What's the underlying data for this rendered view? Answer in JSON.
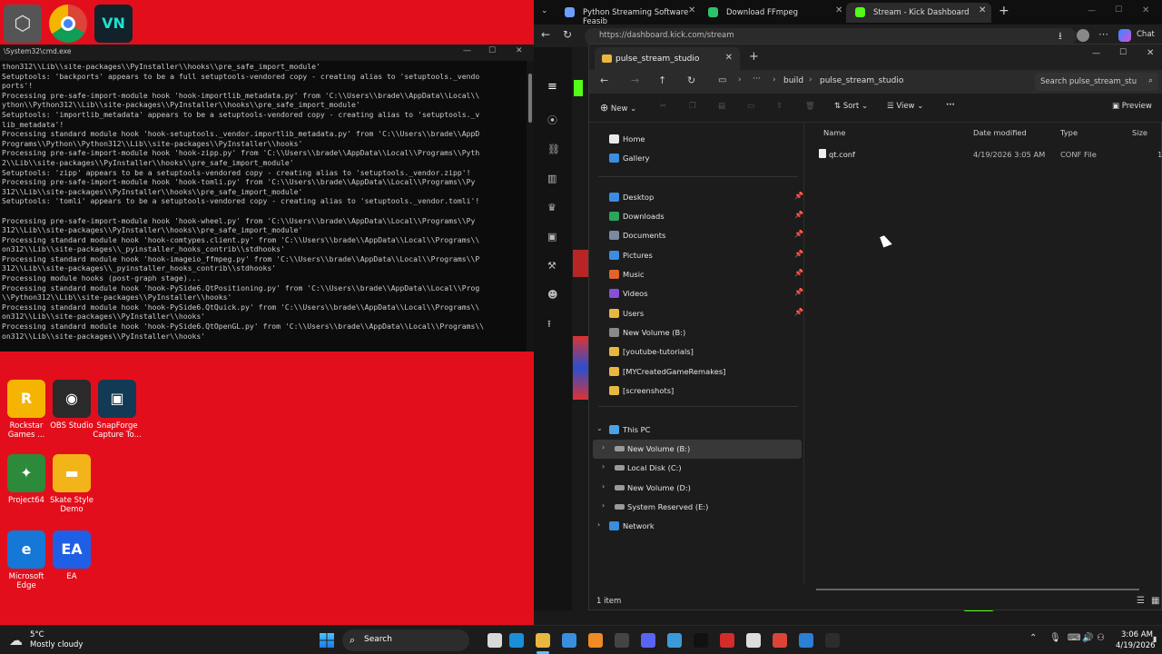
{
  "desktop": {
    "icons_top": [
      {
        "name": "unity"
      },
      {
        "name": "chrome"
      },
      {
        "name": "vegas"
      }
    ],
    "icons": [
      {
        "label": "Rockstar Games ...",
        "glyph": "R",
        "color": "#f5b400"
      },
      {
        "label": "OBS Studio",
        "glyph": "◉",
        "color": "#2a2a2a"
      },
      {
        "label": "SnapForge Capture To...",
        "glyph": "▣",
        "color": "#123a55"
      },
      {
        "label": "Project64",
        "glyph": "✦",
        "color": "#2c8a3a"
      },
      {
        "label": "Skate Style Demo",
        "glyph": "▬",
        "color": "#f2b418"
      },
      {
        "label": "Microsoft Edge",
        "glyph": "e",
        "color": "#1577d6"
      },
      {
        "label": "EA",
        "glyph": "EA",
        "color": "#1f5fe6"
      }
    ]
  },
  "cmd": {
    "title": "\\System32\\cmd.exe",
    "lines": [
      "thon312\\\\Lib\\\\site-packages\\\\PyInstaller\\\\hooks\\\\pre_safe_import_module'",
      "Setuptools: 'backports' appears to be a full setuptools-vendored copy - creating alias to 'setuptools._vendo",
      "ports'!",
      "Processing pre-safe-import-module hook 'hook-importlib_metadata.py' from 'C:\\\\Users\\\\brade\\\\AppData\\\\Local\\\\",
      "ython\\\\Python312\\\\Lib\\\\site-packages\\\\PyInstaller\\\\hooks\\\\pre_safe_import_module'",
      "Setuptools: 'importlib_metadata' appears to be a setuptools-vendored copy - creating alias to 'setuptools._v",
      "lib_metadata'!",
      "Processing standard module hook 'hook-setuptools._vendor.importlib_metadata.py' from 'C:\\\\Users\\\\brade\\\\AppD",
      "Programs\\\\Python\\\\Python312\\\\Lib\\\\site-packages\\\\PyInstaller\\\\hooks'",
      "Processing pre-safe-import-module hook 'hook-zipp.py' from 'C:\\\\Users\\\\brade\\\\AppData\\\\Local\\\\Programs\\\\Pyth",
      "2\\\\Lib\\\\site-packages\\\\PyInstaller\\\\hooks\\\\pre_safe_import_module'",
      "Setuptools: 'zipp' appears to be a setuptools-vendored copy - creating alias to 'setuptools._vendor.zipp'!",
      "Processing pre-safe-import-module hook 'hook-tomli.py' from 'C:\\\\Users\\\\brade\\\\AppData\\\\Local\\\\Programs\\\\Py",
      "312\\\\Lib\\\\site-packages\\\\PyInstaller\\\\hooks\\\\pre_safe_import_module'",
      "Setuptools: 'tomli' appears to be a setuptools-vendored copy - creating alias to 'setuptools._vendor.tomli'!",
      "",
      "Processing pre-safe-import-module hook 'hook-wheel.py' from 'C:\\\\Users\\\\brade\\\\AppData\\\\Local\\\\Programs\\\\Py",
      "312\\\\Lib\\\\site-packages\\\\PyInstaller\\\\hooks\\\\pre_safe_import_module'",
      "Processing standard module hook 'hook-comtypes.client.py' from 'C:\\\\Users\\\\brade\\\\AppData\\\\Local\\\\Programs\\\\",
      "on312\\\\Lib\\\\site-packages\\\\_pyinstaller_hooks_contrib\\\\stdhooks'",
      "Processing standard module hook 'hook-imageio_ffmpeg.py' from 'C:\\\\Users\\\\brade\\\\AppData\\\\Local\\\\Programs\\\\P",
      "312\\\\Lib\\\\site-packages\\\\_pyinstaller_hooks_contrib\\\\stdhooks'",
      "Processing module hooks (post-graph stage)...",
      "Processing standard module hook 'hook-PySide6.QtPositioning.py' from 'C:\\\\Users\\\\brade\\\\AppData\\\\Local\\\\Prog",
      "\\\\Python312\\\\Lib\\\\site-packages\\\\PyInstaller\\\\hooks'",
      "Processing standard module hook 'hook-PySide6.QtQuick.py' from 'C:\\\\Users\\\\brade\\\\AppData\\\\Local\\\\Programs\\\\",
      "on312\\\\Lib\\\\site-packages\\\\PyInstaller\\\\hooks'",
      "Processing standard module hook 'hook-PySide6.QtOpenGL.py' from 'C:\\\\Users\\\\brade\\\\AppData\\\\Local\\\\Programs\\\\",
      "on312\\\\Lib\\\\site-packages\\\\PyInstaller\\\\hooks'"
    ]
  },
  "browser": {
    "tabs": [
      {
        "label": "Python Streaming Software Feasib",
        "color": "#6aa0ff"
      },
      {
        "label": "Download FFmpeg",
        "color": "#2ec26a"
      },
      {
        "label": "Stream - Kick Dashboard",
        "color": "#53fc18"
      }
    ],
    "url": "https://dashboard.kick.com/stream",
    "chat_label": "Chat"
  },
  "explorer": {
    "tab_title": "pulse_stream_studio",
    "breadcrumb": [
      "build",
      "pulse_stream_studio"
    ],
    "search_placeholder": "Search pulse_stream_stu",
    "toolbar": {
      "new": "New",
      "sort": "Sort",
      "view": "View",
      "more": "···",
      "preview": "Preview"
    },
    "nav": [
      {
        "label": "Home",
        "icon": "home",
        "color": "#e9e9e9"
      },
      {
        "label": "Gallery",
        "icon": "gallery",
        "color": "#3b8de0"
      },
      {
        "label": "Desktop",
        "icon": "desktop",
        "color": "#3b8de0",
        "pinned": true
      },
      {
        "label": "Downloads",
        "icon": "downloads",
        "color": "#2aa55a",
        "pinned": true
      },
      {
        "label": "Documents",
        "icon": "documents",
        "color": "#7a8aa0",
        "pinned": true
      },
      {
        "label": "Pictures",
        "icon": "pictures",
        "color": "#3b8de0",
        "pinned": true
      },
      {
        "label": "Music",
        "icon": "music",
        "color": "#e0642b",
        "pinned": true
      },
      {
        "label": "Videos",
        "icon": "videos",
        "color": "#8a4fd8",
        "pinned": true
      },
      {
        "label": "Users",
        "icon": "folder",
        "color": "#e8b73f",
        "pinned": true
      },
      {
        "label": "New Volume (B:)",
        "icon": "drive",
        "color": "#8a8a8a"
      },
      {
        "label": "[youtube-tutorials]",
        "icon": "folder",
        "color": "#e8b73f"
      },
      {
        "label": "[MYCreatedGameRemakes]",
        "icon": "folder",
        "color": "#e8b73f"
      },
      {
        "label": "[screenshots]",
        "icon": "folder",
        "color": "#e8b73f"
      }
    ],
    "this_pc": {
      "label": "This PC",
      "drives": [
        {
          "label": "New Volume (B:)",
          "selected": true
        },
        {
          "label": "Local Disk (C:)"
        },
        {
          "label": "New Volume (D:)"
        },
        {
          "label": "System Reserved (E:)"
        }
      ],
      "network": "Network"
    },
    "columns": {
      "name": "Name",
      "date": "Date modified",
      "type": "Type",
      "size": "Size"
    },
    "files": [
      {
        "name": "qt.conf",
        "date": "4/19/2026 3:05 AM",
        "type": "CONF File",
        "size": "1"
      }
    ],
    "status": "1 item"
  },
  "taskbar": {
    "weather_temp": "5°C",
    "weather_desc": "Mostly cloudy",
    "search_label": "Search",
    "time": "3:06 AM",
    "date": "4/19/2026"
  }
}
